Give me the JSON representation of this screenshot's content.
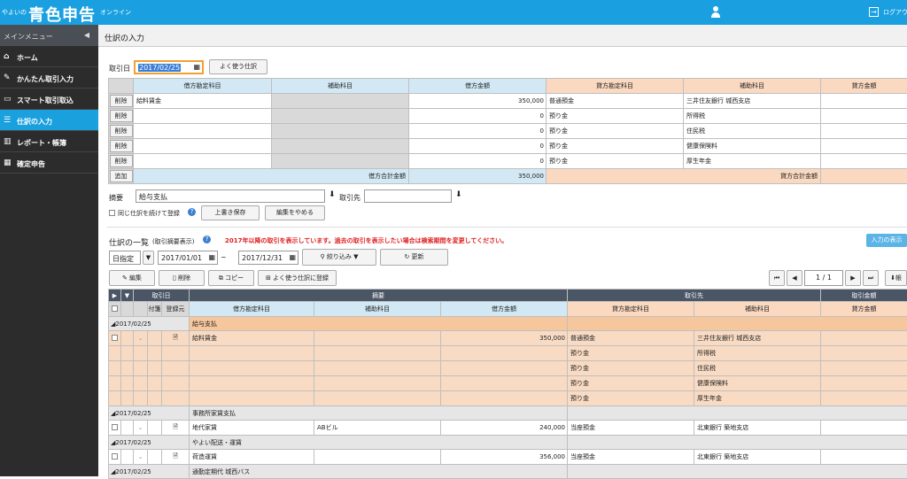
{
  "topbar": {
    "logo_small": "やよいの",
    "logo_big": "青色申告",
    "logo_online": "オンライン",
    "logout": "ログアウ"
  },
  "sidebar": {
    "header": "メインメニュー",
    "items": [
      {
        "label": "ホーム",
        "icon": "home-icon"
      },
      {
        "label": "かんたん取引入力",
        "icon": "pencil-icon"
      },
      {
        "label": "スマート取引取込",
        "icon": "import-icon"
      },
      {
        "label": "仕訳の入力",
        "icon": "journal-icon"
      },
      {
        "label": "レポート・帳簿",
        "icon": "chart-icon"
      },
      {
        "label": "確定申告",
        "icon": "calculator-icon"
      }
    ]
  },
  "page": {
    "title": "仕訳の入力"
  },
  "entry": {
    "date_label": "取引日",
    "date_value": "2017/02/25",
    "frequent_btn": "よく使う仕訳",
    "headers": {
      "debit_account": "借方勘定科目",
      "debit_sub": "補助科目",
      "debit_amount": "借方金額",
      "credit_account": "貸方勘定科目",
      "credit_sub": "補助科目",
      "credit_amount": "貸方金額"
    },
    "delete_label": "削除",
    "add_label": "追加",
    "rows": [
      {
        "debit_account": "給料賃金",
        "amount": "350,000",
        "credit_account": "普通預金",
        "credit_sub": "三井住友銀行 城西支店"
      },
      {
        "debit_account": "",
        "amount": "0",
        "credit_account": "預り金",
        "credit_sub": "所得税"
      },
      {
        "debit_account": "",
        "amount": "0",
        "credit_account": "預り金",
        "credit_sub": "住民税"
      },
      {
        "debit_account": "",
        "amount": "0",
        "credit_account": "預り金",
        "credit_sub": "健康保険料"
      },
      {
        "debit_account": "",
        "amount": "0",
        "credit_account": "預り金",
        "credit_sub": "厚生年金"
      }
    ],
    "debit_total_label": "借方合計金額",
    "debit_total": "350,000",
    "credit_total_label": "貸方合計金額",
    "memo_label": "摘要",
    "memo_value": "給与支払",
    "partner_label": "取引先",
    "continue_label": "同じ仕訳を続けて登録",
    "overwrite_btn": "上書き保存",
    "cancel_btn": "編集をやめる"
  },
  "list": {
    "title": "仕訳の一覧",
    "subtitle": "(取引摘要表示)",
    "notice": "2017年以降の取引を表示しています。過去の取引を表示したい場合は検索期間を変更してください。",
    "input_display_btn": "入力の表示",
    "range_type": "日指定",
    "date_from": "2017/01/01",
    "tilde": "~",
    "date_to": "2017/12/31",
    "filter_btn": "絞り込み",
    "refresh_btn": "更新",
    "edit_btn": "編集",
    "delete_btn": "削除",
    "copy_btn": "コピー",
    "register_btn": "よく使う仕訳に登録",
    "page_current": "1",
    "page_sep": "/",
    "page_total": "1",
    "export_label": "帳",
    "head1": {
      "date": "取引日",
      "memo": "摘要",
      "partner": "取引先",
      "credit_amount": "取引金額"
    },
    "head2": {
      "attach": "付箋",
      "registered": "登録元",
      "debit_account": "借方勘定科目",
      "debit_sub": "補助科目",
      "debit_amount": "借方金額",
      "credit_account": "貸方勘定科目",
      "credit_sub": "補助科目",
      "credit_amount": "貸方金額"
    },
    "groups": [
      {
        "date": "2017/02/25",
        "memo": "給与支払",
        "highlight": true,
        "rows": [
          {
            "debit_account": "給料賃金",
            "debit_sub": "",
            "amount": "350,000",
            "credit_account": "普通預金",
            "credit_sub": "三井住友銀行 城西支店",
            "first": true
          },
          {
            "debit_account": "",
            "debit_sub": "",
            "amount": "",
            "credit_account": "預り金",
            "credit_sub": "所得税"
          },
          {
            "debit_account": "",
            "debit_sub": "",
            "amount": "",
            "credit_account": "預り金",
            "credit_sub": "住民税"
          },
          {
            "debit_account": "",
            "debit_sub": "",
            "amount": "",
            "credit_account": "預り金",
            "credit_sub": "健康保険料"
          },
          {
            "debit_account": "",
            "debit_sub": "",
            "amount": "",
            "credit_account": "預り金",
            "credit_sub": "厚生年金"
          }
        ]
      },
      {
        "date": "2017/02/25",
        "memo": "事務所家賃支払",
        "highlight": false,
        "rows": [
          {
            "debit_account": "地代家賃",
            "debit_sub": "ABビル",
            "amount": "240,000",
            "credit_account": "当座預金",
            "credit_sub": "北東銀行 築地支店",
            "first": true
          }
        ]
      },
      {
        "date": "2017/02/25",
        "memo": "やよい配送・運賃",
        "highlight": false,
        "rows": [
          {
            "debit_account": "荷造運賃",
            "debit_sub": "",
            "amount": "356,000",
            "credit_account": "当座預金",
            "credit_sub": "北東銀行 築地支店",
            "first": true
          }
        ]
      },
      {
        "date": "2017/02/25",
        "memo": "通勤定期代 城西バス",
        "highlight": false,
        "rows": []
      }
    ]
  }
}
